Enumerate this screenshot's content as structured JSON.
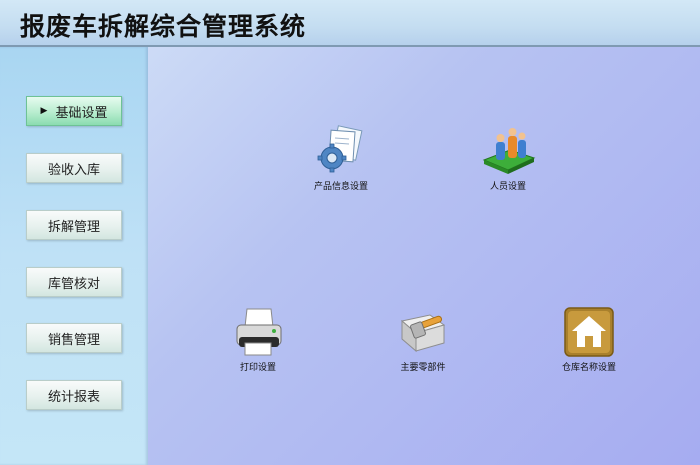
{
  "app": {
    "title": "报废车拆解综合管理系统"
  },
  "sidebar": {
    "items": [
      {
        "label": "基础设置",
        "active": true
      },
      {
        "label": "验收入库"
      },
      {
        "label": "拆解管理"
      },
      {
        "label": "库管核对"
      },
      {
        "label": "销售管理"
      },
      {
        "label": "统计报表"
      }
    ]
  },
  "tiles": [
    {
      "label": "产品信息设置",
      "icon": "product-settings-icon"
    },
    {
      "label": "人员设置",
      "icon": "personnel-icon"
    },
    {
      "label": "打印设置",
      "icon": "printer-icon"
    },
    {
      "label": "主要零部件",
      "icon": "parts-icon"
    },
    {
      "label": "仓库名称设置",
      "icon": "warehouse-icon"
    }
  ],
  "colors": {
    "active_nav": "#b8edcf",
    "content_bg": "#b7c3f2",
    "sidebar_bg": "#bfe1f6"
  }
}
